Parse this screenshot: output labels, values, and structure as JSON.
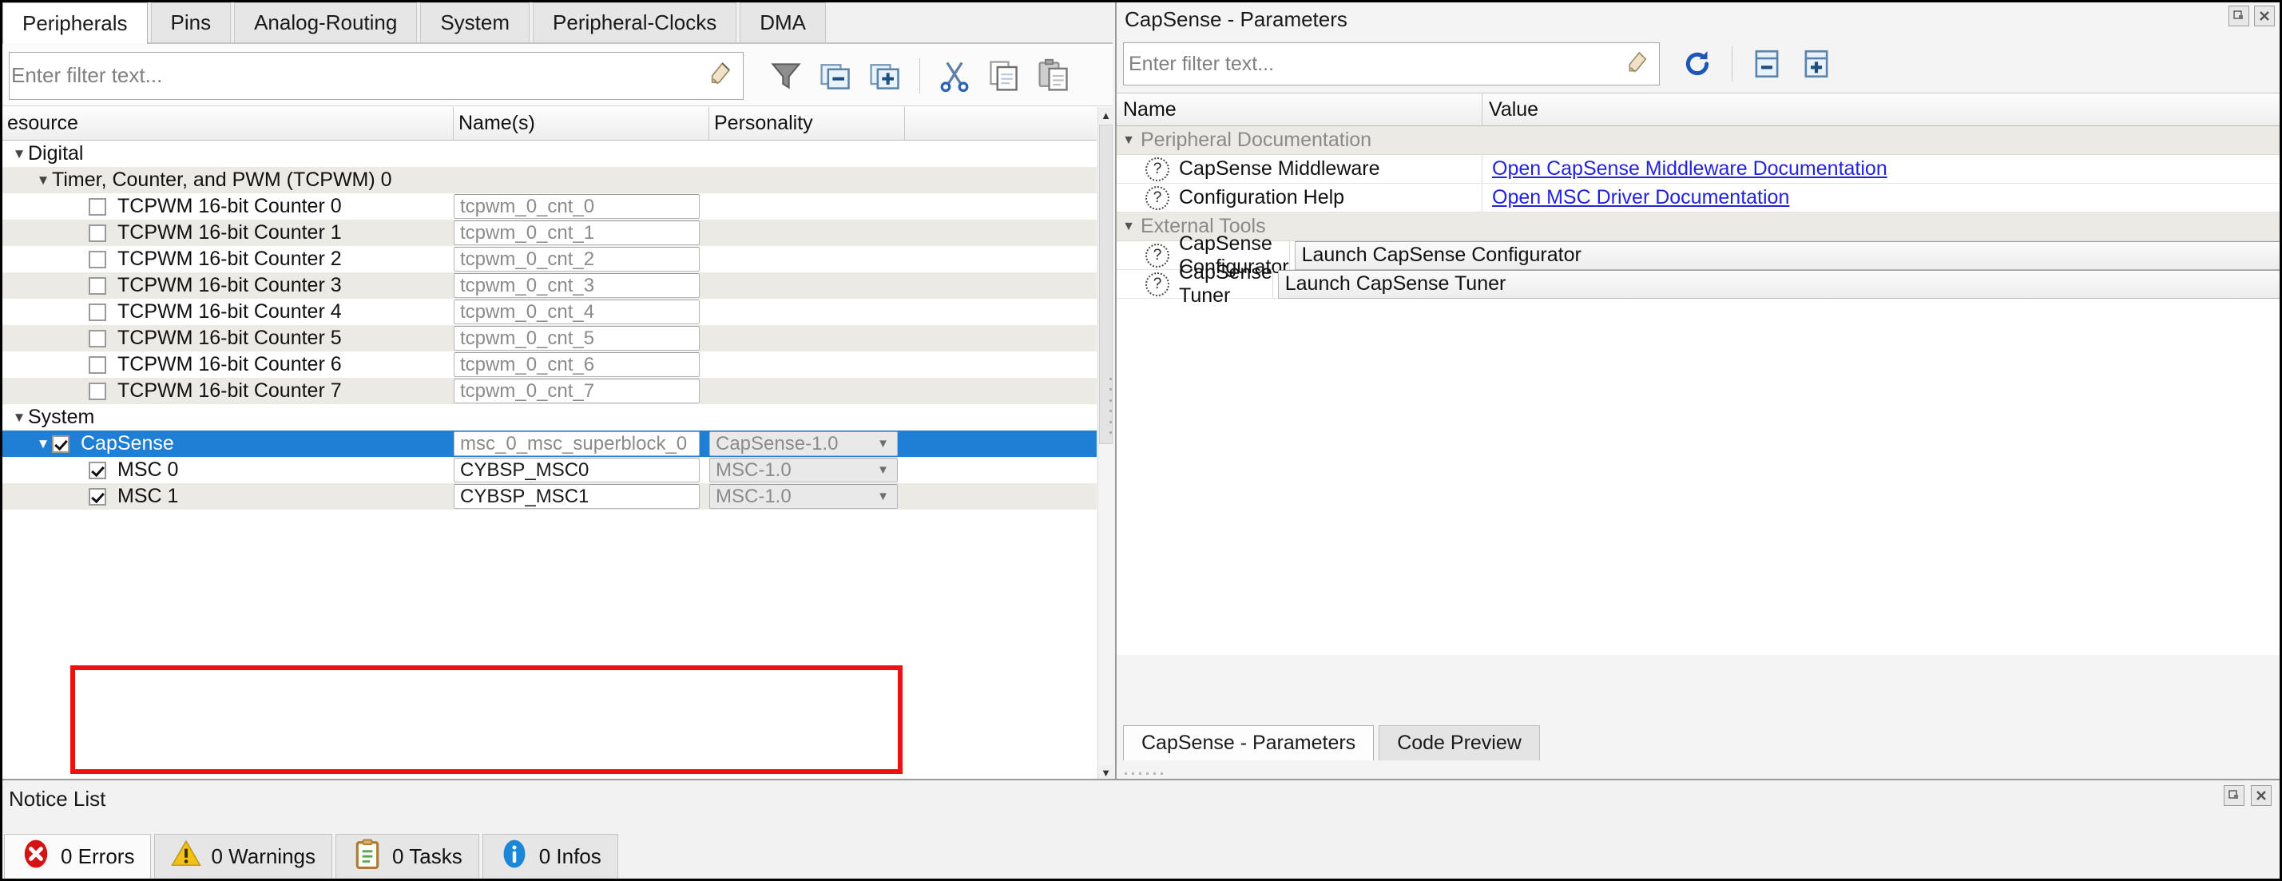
{
  "window": {
    "maximize_icon": "restore-icon",
    "close_icon": "close-icon"
  },
  "left_panel": {
    "tabs": [
      {
        "label": "Peripherals",
        "active": true
      },
      {
        "label": "Pins",
        "active": false
      },
      {
        "label": "Analog-Routing",
        "active": false
      },
      {
        "label": "System",
        "active": false
      },
      {
        "label": "Peripheral-Clocks",
        "active": false
      },
      {
        "label": "DMA",
        "active": false
      }
    ],
    "filter": {
      "placeholder": "Enter filter text...",
      "value": "",
      "clear_icon": "clear-filter-icon"
    },
    "toolbar": [
      {
        "name": "filter-icon",
        "tooltip": "Filter"
      },
      {
        "name": "collapse-all-icon",
        "tooltip": "Collapse All"
      },
      {
        "name": "expand-all-icon",
        "tooltip": "Expand All"
      },
      {
        "name": "cut-icon",
        "tooltip": "Cut"
      },
      {
        "name": "copy-icon",
        "tooltip": "Copy"
      },
      {
        "name": "paste-icon",
        "tooltip": "Paste"
      }
    ],
    "columns": [
      "esource",
      "Name(s)",
      "Personality",
      ""
    ],
    "rows": [
      {
        "type": "group",
        "indent": 0,
        "expanded": true,
        "label": "Digital",
        "stripe": "white"
      },
      {
        "type": "group",
        "indent": 1,
        "expanded": true,
        "label": "Timer, Counter, and PWM (TCPWM) 0",
        "stripe": "alt"
      },
      {
        "type": "item",
        "indent": 2,
        "checked": false,
        "label": "TCPWM 16-bit Counter 0",
        "name": "tcpwm_0_cnt_0",
        "name_filled": false,
        "personality": "",
        "stripe": "white"
      },
      {
        "type": "item",
        "indent": 2,
        "checked": false,
        "label": "TCPWM 16-bit Counter 1",
        "name": "tcpwm_0_cnt_1",
        "name_filled": false,
        "personality": "",
        "stripe": "alt"
      },
      {
        "type": "item",
        "indent": 2,
        "checked": false,
        "label": "TCPWM 16-bit Counter 2",
        "name": "tcpwm_0_cnt_2",
        "name_filled": false,
        "personality": "",
        "stripe": "white"
      },
      {
        "type": "item",
        "indent": 2,
        "checked": false,
        "label": "TCPWM 16-bit Counter 3",
        "name": "tcpwm_0_cnt_3",
        "name_filled": false,
        "personality": "",
        "stripe": "alt"
      },
      {
        "type": "item",
        "indent": 2,
        "checked": false,
        "label": "TCPWM 16-bit Counter 4",
        "name": "tcpwm_0_cnt_4",
        "name_filled": false,
        "personality": "",
        "stripe": "white"
      },
      {
        "type": "item",
        "indent": 2,
        "checked": false,
        "label": "TCPWM 16-bit Counter 5",
        "name": "tcpwm_0_cnt_5",
        "name_filled": false,
        "personality": "",
        "stripe": "alt"
      },
      {
        "type": "item",
        "indent": 2,
        "checked": false,
        "label": "TCPWM 16-bit Counter 6",
        "name": "tcpwm_0_cnt_6",
        "name_filled": false,
        "personality": "",
        "stripe": "white"
      },
      {
        "type": "item",
        "indent": 2,
        "checked": false,
        "label": "TCPWM 16-bit Counter 7",
        "name": "tcpwm_0_cnt_7",
        "name_filled": false,
        "personality": "",
        "stripe": "alt"
      },
      {
        "type": "group",
        "indent": 0,
        "expanded": true,
        "label": "System",
        "stripe": "white"
      },
      {
        "type": "item",
        "indent": 1,
        "expanded": true,
        "checked": true,
        "selected": true,
        "label": "CapSense",
        "name": "msc_0_msc_superblock_0",
        "name_filled": false,
        "personality": "CapSense-1.0",
        "stripe": "sel"
      },
      {
        "type": "item",
        "indent": 2,
        "checked": true,
        "label": "MSC 0",
        "name": "CYBSP_MSC0",
        "name_filled": true,
        "personality": "MSC-1.0",
        "stripe": "white",
        "highlighted": true
      },
      {
        "type": "item",
        "indent": 2,
        "checked": true,
        "label": "MSC 1",
        "name": "CYBSP_MSC1",
        "name_filled": true,
        "personality": "MSC-1.0",
        "stripe": "alt",
        "highlighted": true
      }
    ],
    "highlight_color": "#ee1111",
    "selection_color": "#1f7fd4"
  },
  "right_panel": {
    "title": "CapSense - Parameters",
    "filter": {
      "placeholder": "Enter filter text...",
      "value": "",
      "clear_icon": "clear-filter-icon"
    },
    "toolbar": [
      {
        "name": "refresh-icon",
        "tooltip": "Refresh"
      },
      {
        "name": "collapse-all-icon",
        "tooltip": "Collapse All"
      },
      {
        "name": "expand-all-icon",
        "tooltip": "Expand All"
      }
    ],
    "columns": [
      "Name",
      "Value"
    ],
    "groups": [
      {
        "label": "Peripheral Documentation",
        "expanded": true,
        "items": [
          {
            "icon": "help-icon",
            "label": "CapSense Middleware",
            "value": "Open CapSense Middleware Documentation",
            "value_type": "link"
          },
          {
            "icon": "help-icon",
            "label": "Configuration Help",
            "value": "Open MSC Driver Documentation",
            "value_type": "link"
          }
        ]
      },
      {
        "label": "External Tools",
        "expanded": true,
        "items": [
          {
            "icon": "help-icon",
            "label": "CapSense Configurator",
            "value": "Launch CapSense Configurator",
            "value_type": "button",
            "ellipsis": "..."
          },
          {
            "icon": "help-icon",
            "label": "CapSense Tuner",
            "value": "Launch CapSense Tuner",
            "value_type": "button",
            "ellipsis": "..."
          }
        ]
      }
    ],
    "link_color": "#2323dd",
    "tabs": [
      {
        "label": "CapSense - Parameters",
        "active": true
      },
      {
        "label": "Code Preview",
        "active": false
      }
    ]
  },
  "notice_list": {
    "title": "Notice List",
    "tabs": [
      {
        "label": "0 Errors",
        "icon": "error-icon",
        "color": "#d41414",
        "active": true
      },
      {
        "label": "0 Warnings",
        "icon": "warning-icon",
        "color": "#f2c118",
        "active": false
      },
      {
        "label": "0 Tasks",
        "icon": "task-icon",
        "color": "#b07a32",
        "active": false
      },
      {
        "label": "0 Infos",
        "icon": "info-icon",
        "color": "#1b87d6",
        "active": false
      }
    ]
  }
}
